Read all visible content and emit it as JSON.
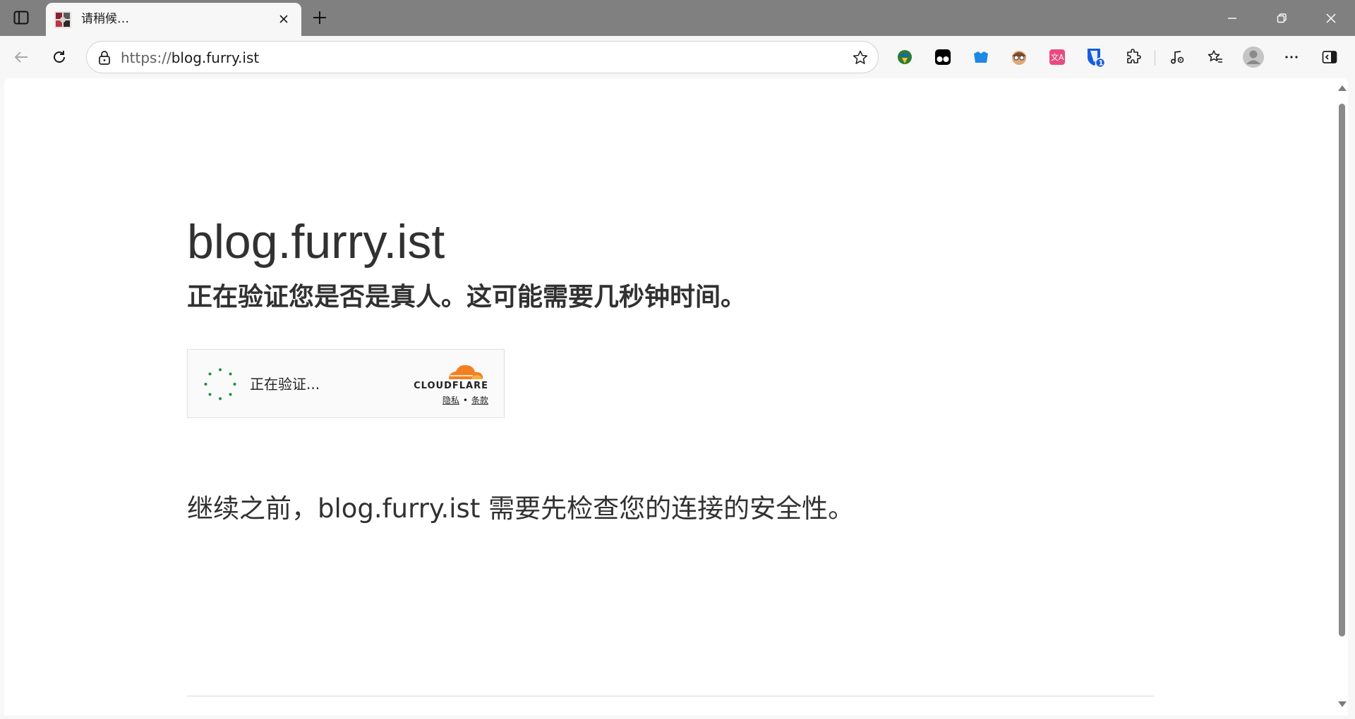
{
  "browser": {
    "tab": {
      "title": "请稍候…"
    },
    "address": {
      "scheme": "https://",
      "host": "blog.furry.ist"
    },
    "extensions": [
      {
        "icon": "globe-downloader-icon"
      },
      {
        "icon": "tampermonkey-icon"
      },
      {
        "icon": "blue-box-extension-icon"
      },
      {
        "icon": "face-avatar-extension-icon"
      },
      {
        "icon": "translate-extension-icon"
      },
      {
        "icon": "bitwarden-icon",
        "badge": "1"
      },
      {
        "icon": "puzzle-extensions-icon"
      }
    ],
    "colors": {
      "titlebar": "#808080",
      "toolbar": "#f7f7f7",
      "page": "#ffffff"
    }
  },
  "page": {
    "site_title": "blog.furry.ist",
    "subtitle": "正在验证您是否是真人。这可能需要几秒钟时间。",
    "widget": {
      "status": "正在验证...",
      "brand": "CLOUDFLARE",
      "privacy_link": "隐私",
      "separator": "•",
      "terms_link": "条款",
      "spinner_color": "#1a8f3c",
      "brand_color": "#f38020"
    },
    "notice": "继续之前，blog.furry.ist 需要先检查您的连接的安全性。"
  }
}
